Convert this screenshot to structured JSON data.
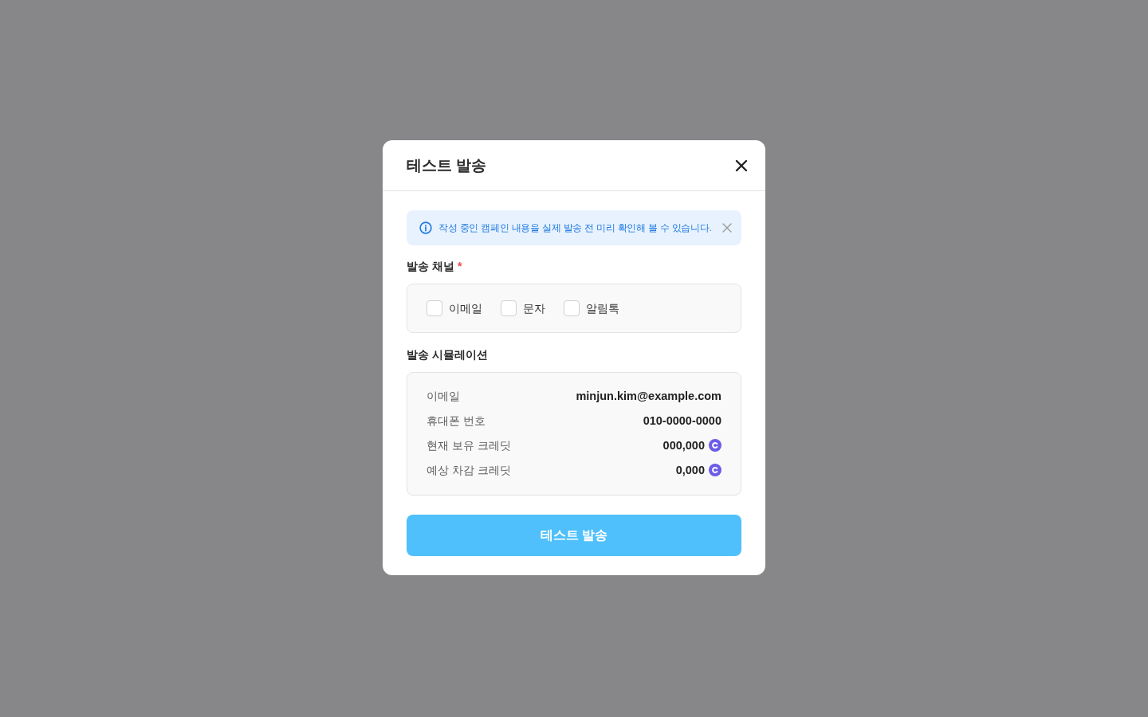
{
  "dialog": {
    "title": "테스트 발송"
  },
  "notice": {
    "text": "작성 중인 캠페인 내용을 실제 발송 전 미리 확인해 볼 수 있습니다."
  },
  "channels": {
    "label": "발송 채널",
    "required_mark": "*",
    "options": [
      {
        "label": "이메일",
        "checked": false
      },
      {
        "label": "문자",
        "checked": false
      },
      {
        "label": "알림톡",
        "checked": false
      }
    ]
  },
  "simulation": {
    "label": "발송 시뮬레이션",
    "rows": [
      {
        "label": "이메일",
        "value": "minjun.kim@example.com",
        "kind": "text"
      },
      {
        "label": "휴대폰 번호",
        "value": "010-0000-0000",
        "kind": "text"
      },
      {
        "label": "현재 보유 크레딧",
        "value": "000,000",
        "kind": "credit"
      },
      {
        "label": "예상 차감 크레딧",
        "value": "0,000",
        "kind": "credit"
      }
    ]
  },
  "submit": {
    "label": "테스트 발송",
    "disabled": true
  }
}
